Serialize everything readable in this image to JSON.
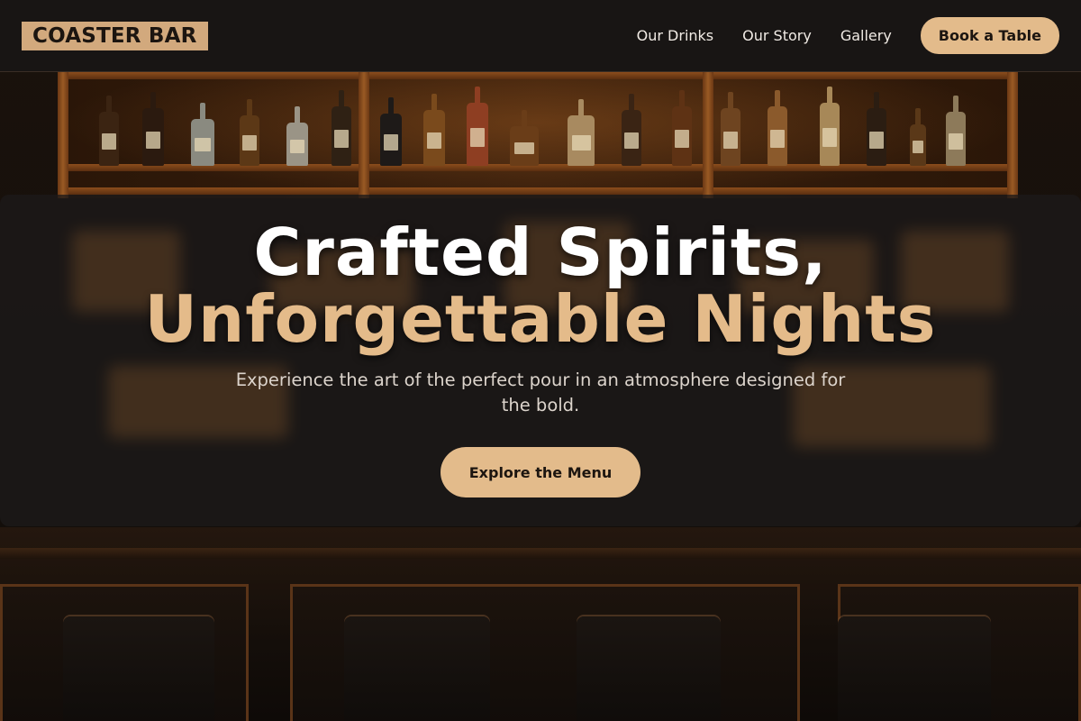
{
  "brand": {
    "logo_text": "COASTER BAR",
    "accent": "#e3bb8b",
    "logo_bg": "#d2a97d"
  },
  "nav": {
    "links": [
      {
        "label": "Our Drinks"
      },
      {
        "label": "Our Story"
      },
      {
        "label": "Gallery"
      }
    ],
    "cta_label": "Book a Table"
  },
  "hero": {
    "title_line1": "Crafted Spirits,",
    "title_line2": "Unforgettable Nights",
    "subtitle": "Experience the art of the perfect pour in an atmosphere designed for the bold.",
    "cta_label": "Explore the Menu",
    "title_color": "#ffffff",
    "title_accent_color": "#e4bb8a"
  }
}
